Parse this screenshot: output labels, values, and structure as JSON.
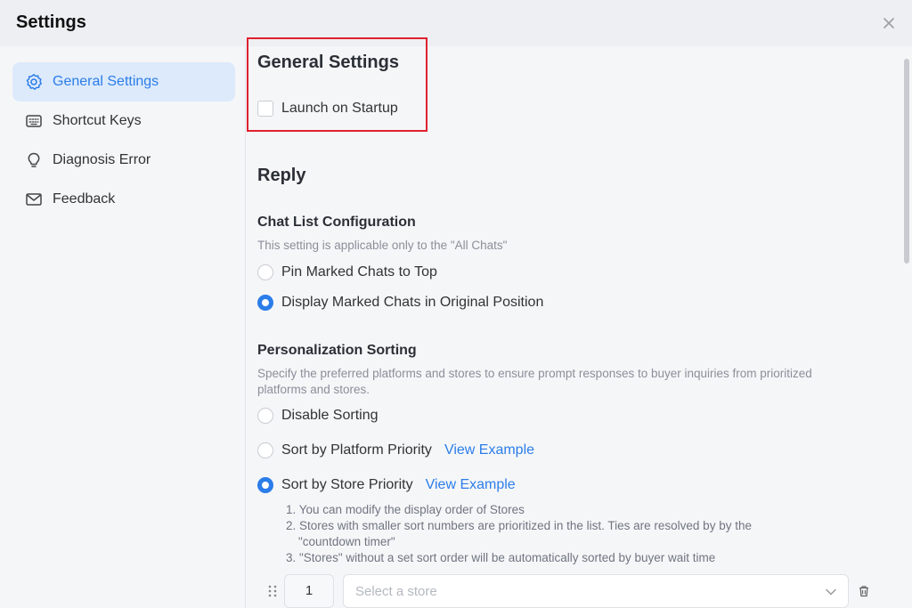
{
  "window": {
    "title": "Settings"
  },
  "sidebar": {
    "items": [
      {
        "label": "General Settings",
        "icon": "gear-icon",
        "active": true
      },
      {
        "label": "Shortcut Keys",
        "icon": "keyboard-icon",
        "active": false
      },
      {
        "label": "Diagnosis Error",
        "icon": "lightbulb-icon",
        "active": false
      },
      {
        "label": "Feedback",
        "icon": "mail-icon",
        "active": false
      }
    ]
  },
  "general": {
    "heading": "General Settings",
    "launch_on_startup": {
      "label": "Launch on Startup",
      "checked": false
    }
  },
  "reply": {
    "heading": "Reply",
    "chat_list": {
      "title": "Chat List Configuration",
      "description": "This setting is applicable only to the \"All Chats\"",
      "options": [
        {
          "label": "Pin Marked Chats to Top",
          "selected": false
        },
        {
          "label": "Display Marked Chats in Original Position",
          "selected": true
        }
      ]
    },
    "sorting": {
      "title": "Personalization Sorting",
      "description_line1": "Specify the preferred platforms and stores to ensure prompt responses to buyer inquiries from prioritized",
      "description_line2": "platforms and stores.",
      "options": [
        {
          "label": "Disable Sorting",
          "selected": false,
          "link": ""
        },
        {
          "label": "Sort by Platform Priority",
          "selected": false,
          "link": "View Example"
        },
        {
          "label": "Sort by Store Priority",
          "selected": true,
          "link": "View Example"
        }
      ],
      "notes": [
        "1. You can modify the display order of Stores",
        "2. Stores with smaller sort numbers are prioritized in the list. Ties are resolved by by the",
        "\"countdown timer\"",
        "3. \"Stores\" without a set sort order will be automatically sorted by buyer wait time"
      ],
      "store_row": {
        "number": "1",
        "placeholder": "Select a store"
      }
    }
  },
  "colors": {
    "accent": "#2b7de9",
    "highlight_border": "#e0212f",
    "active_bg": "#dceafb"
  }
}
